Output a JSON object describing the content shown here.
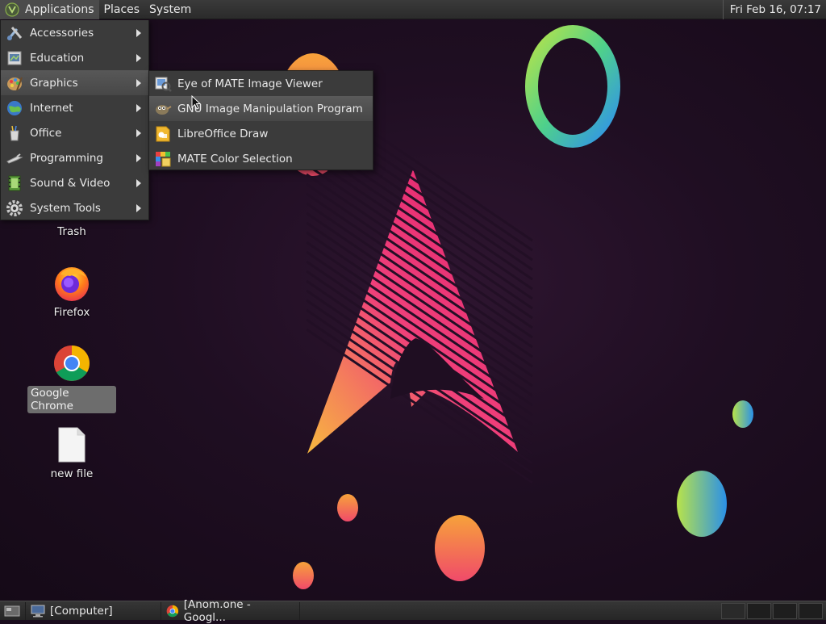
{
  "top_panel": {
    "menus": [
      "Applications",
      "Places",
      "System"
    ],
    "clock": "Fri Feb 16, 07:17"
  },
  "applications_menu": {
    "items": [
      {
        "label": "Accessories",
        "icon": "accessories-icon"
      },
      {
        "label": "Education",
        "icon": "education-icon"
      },
      {
        "label": "Graphics",
        "icon": "graphics-icon"
      },
      {
        "label": "Internet",
        "icon": "internet-icon"
      },
      {
        "label": "Office",
        "icon": "office-icon"
      },
      {
        "label": "Programming",
        "icon": "programming-icon"
      },
      {
        "label": "Sound & Video",
        "icon": "sound-video-icon"
      },
      {
        "label": "System Tools",
        "icon": "system-tools-icon"
      }
    ],
    "highlighted": "Graphics"
  },
  "graphics_submenu": {
    "items": [
      {
        "label": "Eye of MATE Image Viewer",
        "icon": "image-viewer-icon"
      },
      {
        "label": "GNU Image Manipulation Program",
        "icon": "gimp-icon"
      },
      {
        "label": "LibreOffice Draw",
        "icon": "libreoffice-draw-icon"
      },
      {
        "label": "MATE Color Selection",
        "icon": "color-selection-icon"
      }
    ],
    "highlighted": "GNU Image Manipulation Program"
  },
  "desktop": {
    "icons": [
      {
        "label": "Trash",
        "icon": "trash-icon"
      },
      {
        "label": "Firefox",
        "icon": "firefox-icon"
      },
      {
        "label": "Google Chrome",
        "icon": "chrome-icon",
        "selected": true
      },
      {
        "label": "new file",
        "icon": "file-icon"
      }
    ]
  },
  "bottom_panel": {
    "tasks": [
      {
        "label": "[Computer]",
        "icon": "computer-icon"
      },
      {
        "label": "[Anom.one - Googl...",
        "icon": "chrome-icon"
      }
    ]
  },
  "colors": {
    "panel_bg": "#2e2e2e",
    "menu_bg": "#3b3b3b",
    "wallpaper_bg": "#1f0e22",
    "accent_pink": "#e8306e",
    "accent_orange": "#f28c38"
  }
}
